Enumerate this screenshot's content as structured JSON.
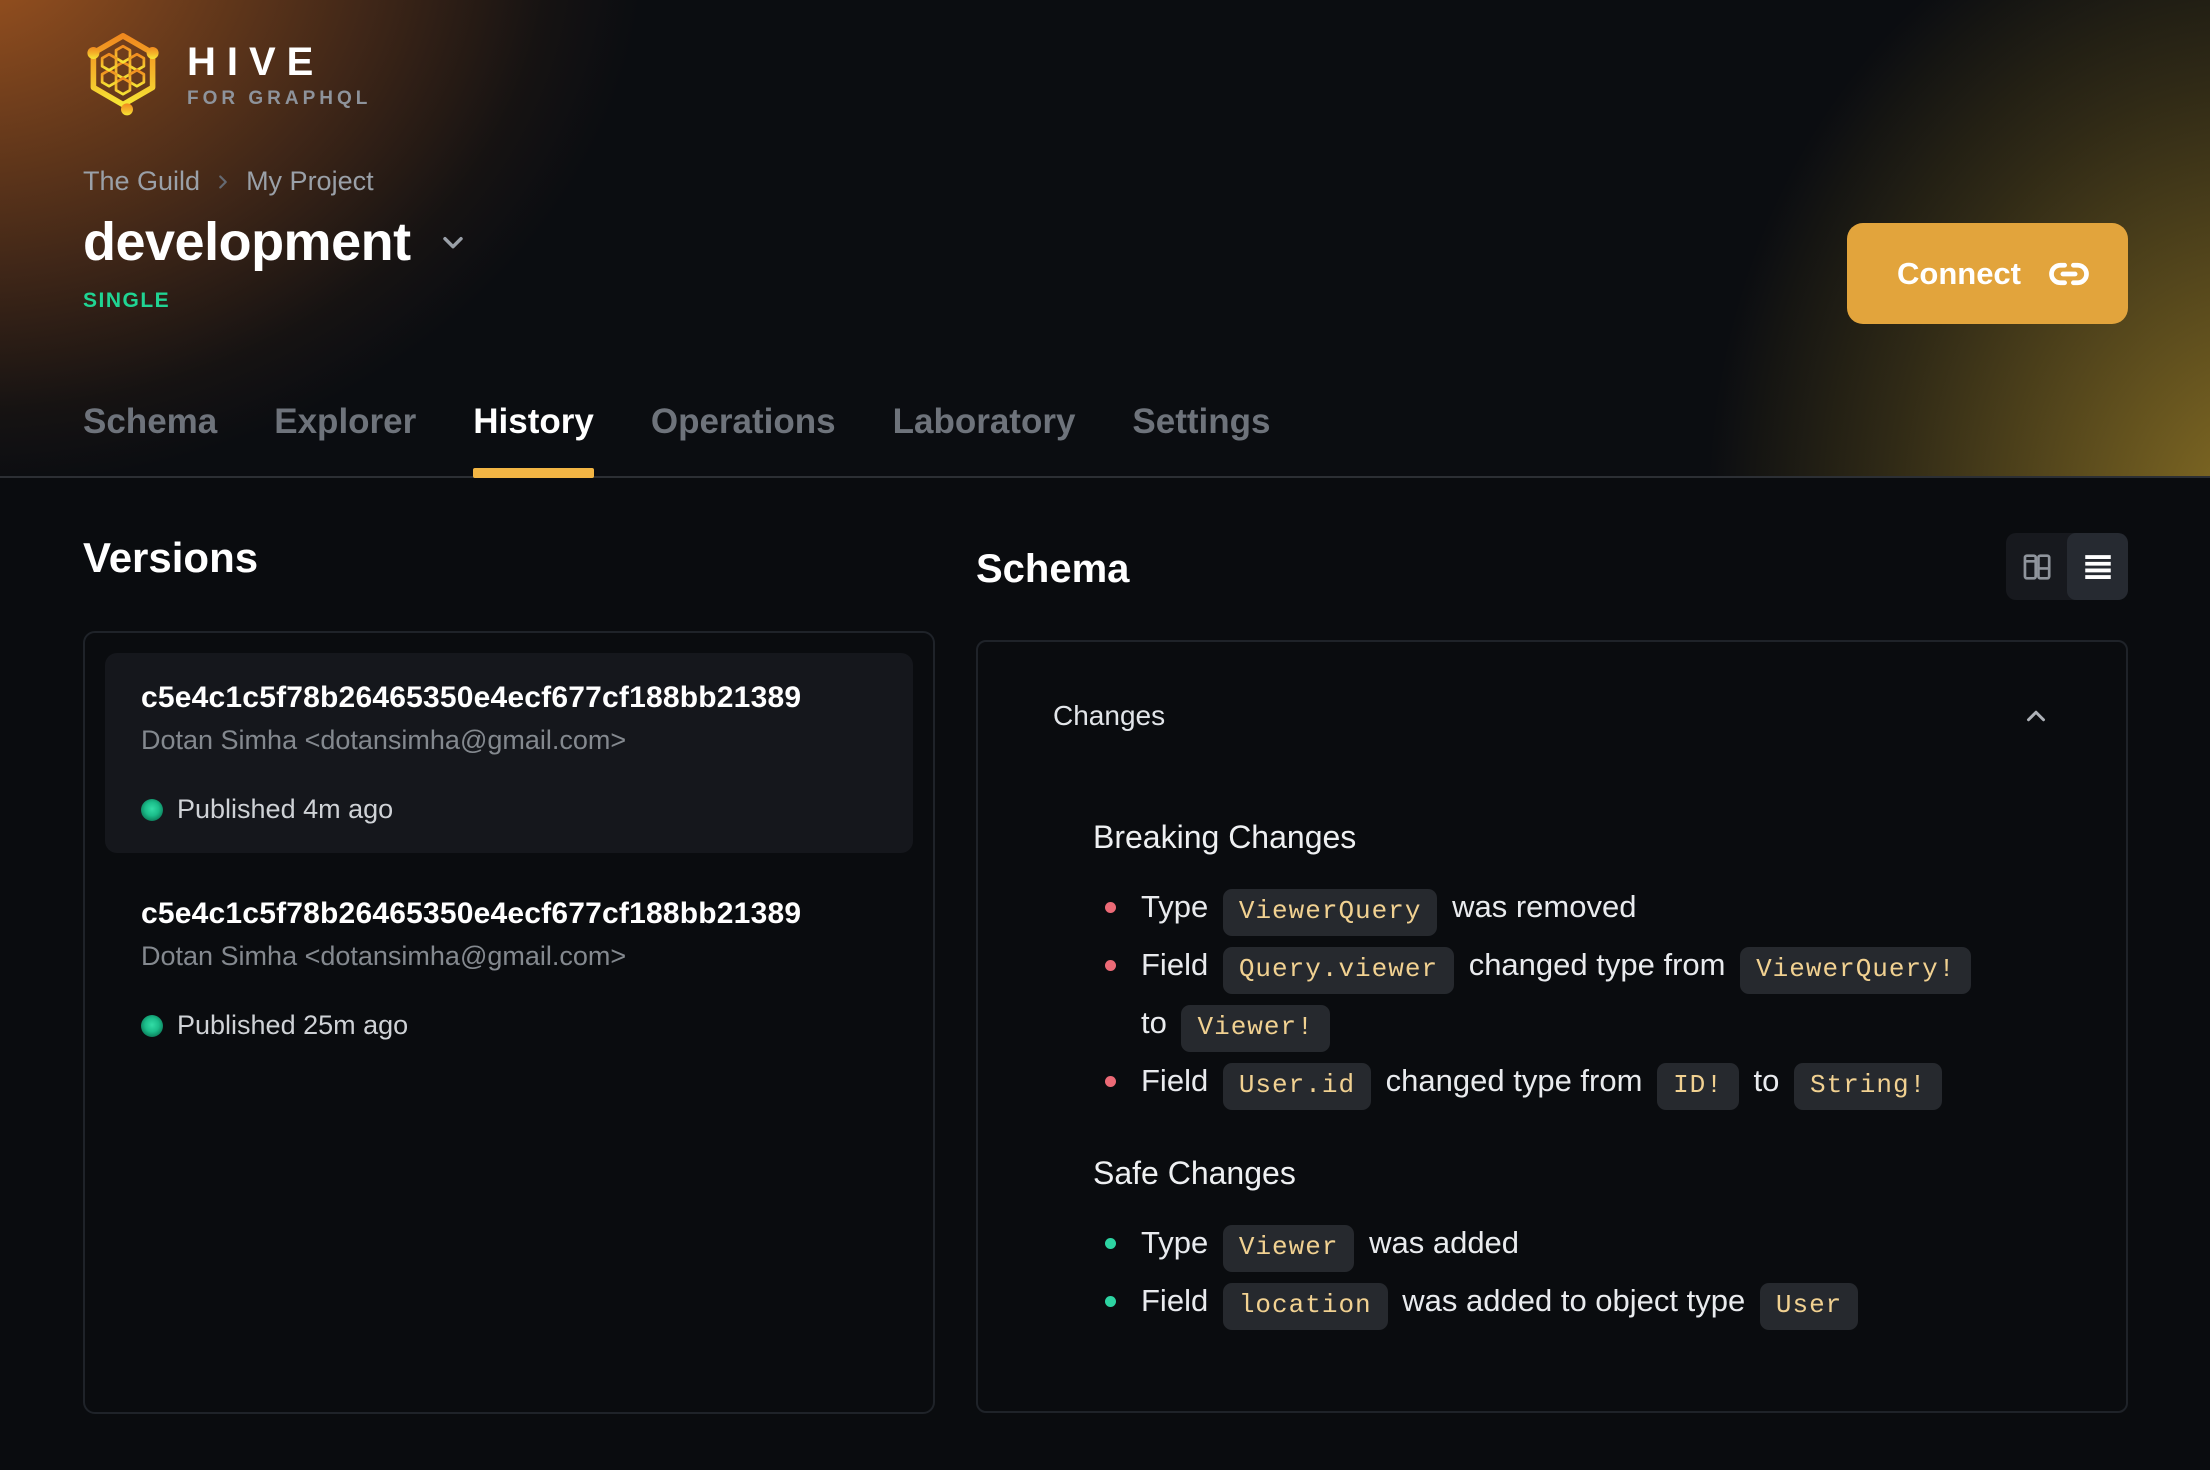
{
  "logo": {
    "title": "HIVE",
    "subtitle": "FOR GRAPHQL"
  },
  "breadcrumb": {
    "org": "The Guild",
    "project": "My Project"
  },
  "target": {
    "name": "development",
    "badge": "SINGLE"
  },
  "connect": {
    "label": "Connect"
  },
  "tabs": [
    {
      "label": "Schema",
      "active": false
    },
    {
      "label": "Explorer",
      "active": false
    },
    {
      "label": "History",
      "active": true
    },
    {
      "label": "Operations",
      "active": false
    },
    {
      "label": "Laboratory",
      "active": false
    },
    {
      "label": "Settings",
      "active": false
    }
  ],
  "versions": {
    "heading": "Versions",
    "items": [
      {
        "hash": "c5e4c1c5f78b26465350e4ecf677cf188bb21389",
        "author": "Dotan Simha <dotansimha@gmail.com>",
        "status": "Published 4m ago",
        "selected": true
      },
      {
        "hash": "c5e4c1c5f78b26465350e4ecf677cf188bb21389",
        "author": "Dotan Simha <dotansimha@gmail.com>",
        "status": "Published 25m ago",
        "selected": false
      }
    ]
  },
  "schema": {
    "heading": "Schema",
    "changes_label": "Changes",
    "groups": [
      {
        "title": "Breaking Changes",
        "kind": "breaking",
        "items": [
          {
            "parts": [
              {
                "t": "text",
                "v": "Type"
              },
              {
                "t": "code",
                "v": "ViewerQuery"
              },
              {
                "t": "text",
                "v": "was removed"
              }
            ]
          },
          {
            "parts": [
              {
                "t": "text",
                "v": "Field"
              },
              {
                "t": "code",
                "v": "Query.viewer"
              },
              {
                "t": "text",
                "v": "changed type from"
              },
              {
                "t": "code",
                "v": "ViewerQuery!"
              },
              {
                "t": "br"
              },
              {
                "t": "text",
                "v": "to"
              },
              {
                "t": "code",
                "v": "Viewer!"
              }
            ]
          },
          {
            "parts": [
              {
                "t": "text",
                "v": "Field"
              },
              {
                "t": "code",
                "v": "User.id"
              },
              {
                "t": "text",
                "v": "changed type from"
              },
              {
                "t": "code",
                "v": "ID!"
              },
              {
                "t": "text",
                "v": "to"
              },
              {
                "t": "code",
                "v": "String!"
              }
            ]
          }
        ]
      },
      {
        "title": "Safe Changes",
        "kind": "safe",
        "items": [
          {
            "parts": [
              {
                "t": "text",
                "v": "Type"
              },
              {
                "t": "code",
                "v": "Viewer"
              },
              {
                "t": "text",
                "v": "was added"
              }
            ]
          },
          {
            "parts": [
              {
                "t": "text",
                "v": "Field"
              },
              {
                "t": "code",
                "v": "location"
              },
              {
                "t": "text",
                "v": "was added to object type"
              },
              {
                "t": "code",
                "v": "User"
              }
            ]
          }
        ]
      }
    ]
  },
  "colors": {
    "accent_yellow": "#f2b544",
    "connect_button": "#e2a43c",
    "badge_green": "#20d493",
    "published_green": "#1bbd8a",
    "breaking_red": "#ec6a76",
    "safe_green": "#2dd4a2",
    "chip_text": "#f1d191",
    "chip_bg": "#26292e",
    "background": "#0a0c0f"
  }
}
